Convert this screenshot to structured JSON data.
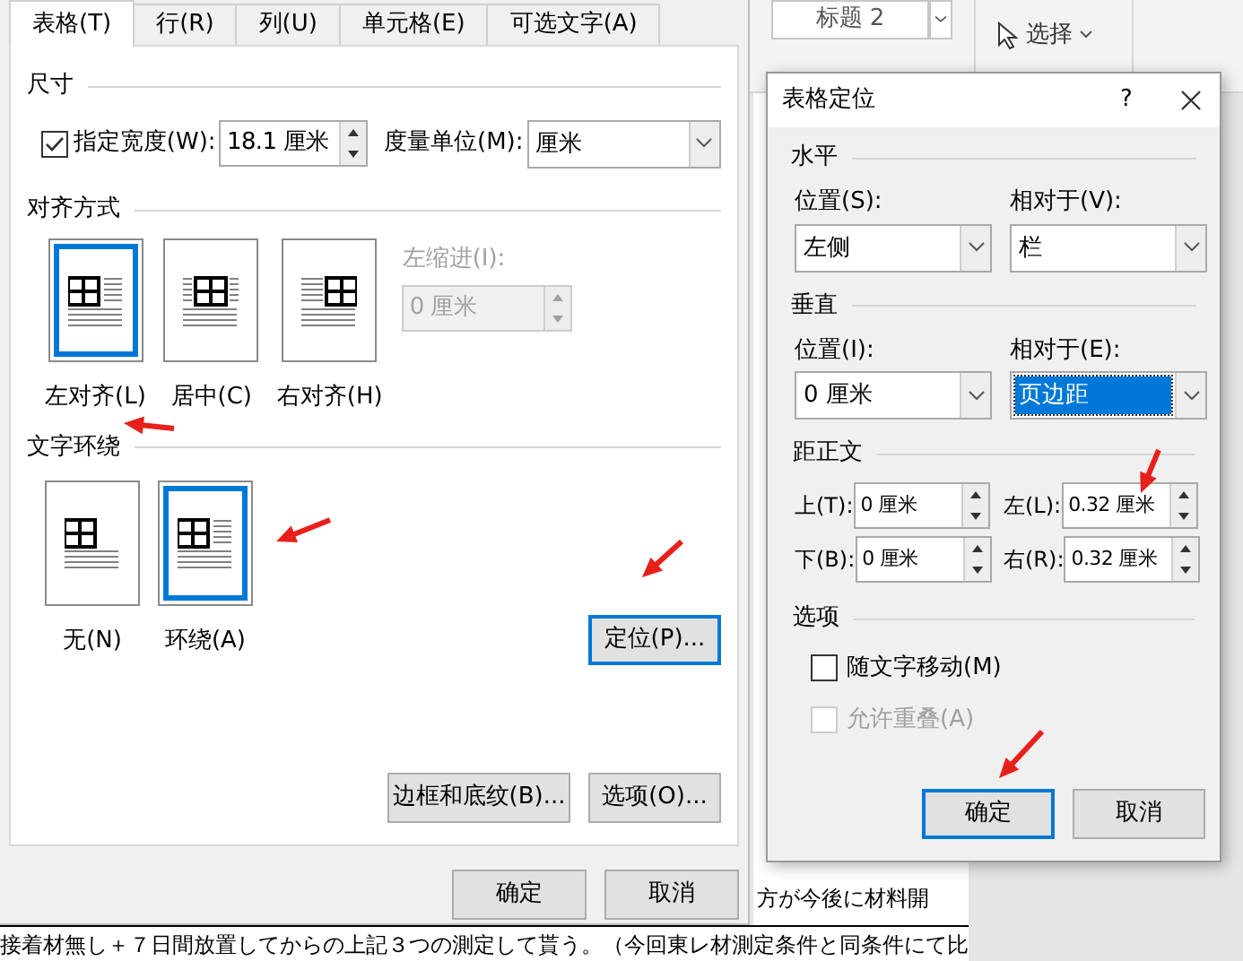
{
  "document": {
    "ribbon": {
      "style_gallery": "标题 2",
      "select_button": "选择"
    },
    "lines": [
      "方が今後に材料開",
      "接着材無し＋７日間放置してからの上記３つの測定して貰う。（今回東レ材測定条件と同条件にて比"
    ]
  },
  "table_properties": {
    "tabs": [
      {
        "label": "表格(T)",
        "selected": true
      },
      {
        "label": "行(R)",
        "selected": false
      },
      {
        "label": "列(U)",
        "selected": false
      },
      {
        "label": "单元格(E)",
        "selected": false
      },
      {
        "label": "可选文字(A)",
        "selected": false
      }
    ],
    "size": {
      "heading": "尺寸",
      "width_checkbox": {
        "label": "指定宽度(W):",
        "checked": true
      },
      "width_value": "18.1 厘米",
      "unit_label": "度量单位(M):",
      "unit_value": "厘米"
    },
    "alignment": {
      "heading": "对齐方式",
      "options": [
        {
          "label": "左对齐(L)",
          "kind": "left",
          "selected": true
        },
        {
          "label": "居中(C)",
          "kind": "center",
          "selected": false
        },
        {
          "label": "右对齐(H)",
          "kind": "right",
          "selected": false
        }
      ],
      "indent_label": "左缩进(I):",
      "indent_value": "0 厘米",
      "indent_disabled": true
    },
    "wrapping": {
      "heading": "文字环绕",
      "options": [
        {
          "label": "无(N)",
          "kind": "none",
          "selected": false
        },
        {
          "label": "环绕(A)",
          "kind": "around",
          "selected": true
        }
      ]
    },
    "positioning_button": {
      "label": "定位(P)...",
      "focused": true
    },
    "borders_button": "边框和底纹(B)...",
    "options_button": "选项(O)...",
    "ok_button": "确定",
    "cancel_button": "取消"
  },
  "table_positioning": {
    "title": "表格定位",
    "help_button": "?",
    "horizontal": {
      "heading": "水平",
      "position_label": "位置(S):",
      "position_value": "左侧",
      "relative_label": "相对于(V):",
      "relative_value": "栏",
      "relative_highlighted": false
    },
    "vertical": {
      "heading": "垂直",
      "position_label": "位置(I):",
      "position_value": "0 厘米",
      "relative_label": "相对于(E):",
      "relative_value": "页边距",
      "relative_highlighted": true
    },
    "distance": {
      "heading": "距正文",
      "fields": [
        {
          "label": "上(T):",
          "value": "0 厘米"
        },
        {
          "label": "左(L):",
          "value": "0.32 厘米"
        },
        {
          "label": "下(B):",
          "value": "0 厘米"
        },
        {
          "label": "右(R):",
          "value": "0.32 厘米"
        }
      ]
    },
    "options": {
      "heading": "选项",
      "checkboxes": [
        {
          "label": "随文字移动(M)",
          "checked": false,
          "disabled": false
        },
        {
          "label": "允许重叠(A)",
          "checked": false,
          "disabled": true
        }
      ]
    },
    "ok_button": {
      "label": "确定",
      "focused": true
    },
    "cancel_button": "取消"
  }
}
